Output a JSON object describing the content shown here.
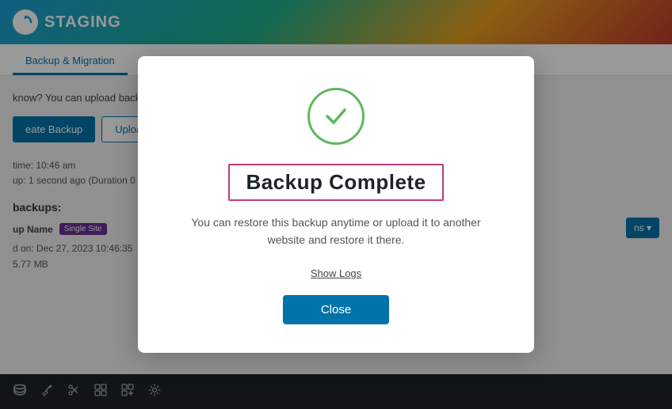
{
  "header": {
    "logo_icon": "↻",
    "logo_text": "STAGING"
  },
  "tabs": {
    "items": [
      {
        "label": "Backup & Migration",
        "active": true
      }
    ]
  },
  "content": {
    "info_text": "know? You can upload backu",
    "buttons": {
      "create_backup": "eate Backup",
      "upload": "Uploa"
    },
    "meta_lines": [
      "time: 10:46 am",
      "up: 1 second ago (Duration 0 m"
    ],
    "section_title": "backups:",
    "backup_col_header": "up Name",
    "badge_label": "Single Site",
    "table_meta_lines": [
      "d on: Dec 27, 2023 10:46:35",
      "5.77 MB"
    ],
    "actions_button": "ns ▾"
  },
  "modal": {
    "title": "Backup Complete",
    "description": "You can restore this backup anytime or upload it to another website and restore it there.",
    "show_logs_label": "Show Logs",
    "close_button_label": "Close",
    "check_color": "#5cb85c",
    "title_border_color": "#c0397a"
  },
  "toolbar": {
    "icons": [
      "⊞",
      "⚒",
      "✂",
      "▦",
      "⊕",
      "⚙"
    ]
  }
}
